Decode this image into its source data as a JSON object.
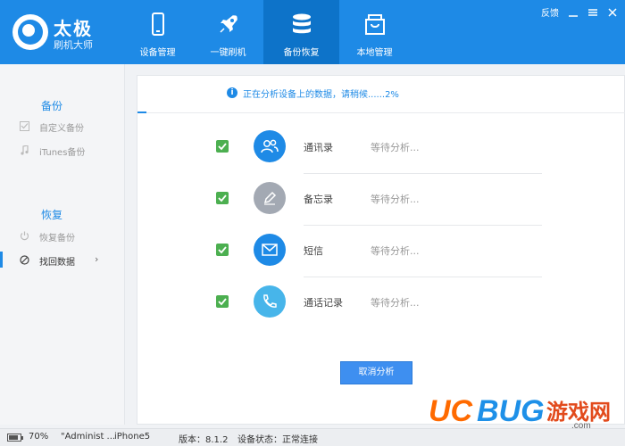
{
  "app": {
    "title": "太极",
    "subtitle": "刷机大师"
  },
  "nav": {
    "items": [
      {
        "label": "设备管理",
        "icon": "phone-icon"
      },
      {
        "label": "一键刷机",
        "icon": "rocket-icon"
      },
      {
        "label": "备份恢复",
        "icon": "database-icon",
        "active": true
      },
      {
        "label": "本地管理",
        "icon": "box-icon"
      }
    ]
  },
  "top_links": {
    "feedback": "反馈"
  },
  "sidebar": {
    "backup_title": "备份",
    "backup_items": [
      {
        "label": "自定义备份",
        "icon": "checklist-icon"
      },
      {
        "label": "iTunes备份",
        "icon": "music-note-icon"
      }
    ],
    "restore_title": "恢复",
    "restore_items": [
      {
        "label": "恢复备份",
        "icon": "power-icon"
      },
      {
        "label": "找回数据",
        "icon": "no-entry-icon",
        "active": true
      }
    ]
  },
  "main": {
    "status_message": "正在分析设备上的数据，请稍候......2%",
    "progress_percent": 2,
    "rows": [
      {
        "name": "通讯录",
        "state": "等待分析...",
        "icon": "contacts-icon",
        "color": "#1e8ae6",
        "checked": true
      },
      {
        "name": "备忘录",
        "state": "等待分析...",
        "icon": "pencil-icon",
        "color": "#a3a9b3",
        "checked": true
      },
      {
        "name": "短信",
        "state": "等待分析...",
        "icon": "envelope-icon",
        "color": "#1e8ae6",
        "checked": true
      },
      {
        "name": "通话记录",
        "state": "等待分析...",
        "icon": "phone-handset-icon",
        "color": "#47b5ea",
        "checked": true
      }
    ],
    "cancel_label": "取消分析"
  },
  "footer": {
    "battery": "70%",
    "user": "\"Administ ...",
    "device": "iPhone5",
    "version": "版本：8.1.2",
    "device_status": "设备状态：正常连接"
  },
  "watermark": {
    "text": "UCBUG游戏网",
    "domain": ".com"
  },
  "colors": {
    "primary": "#1e8ae6",
    "active_nav": "#0d73c9",
    "check_green": "#4caf50"
  }
}
